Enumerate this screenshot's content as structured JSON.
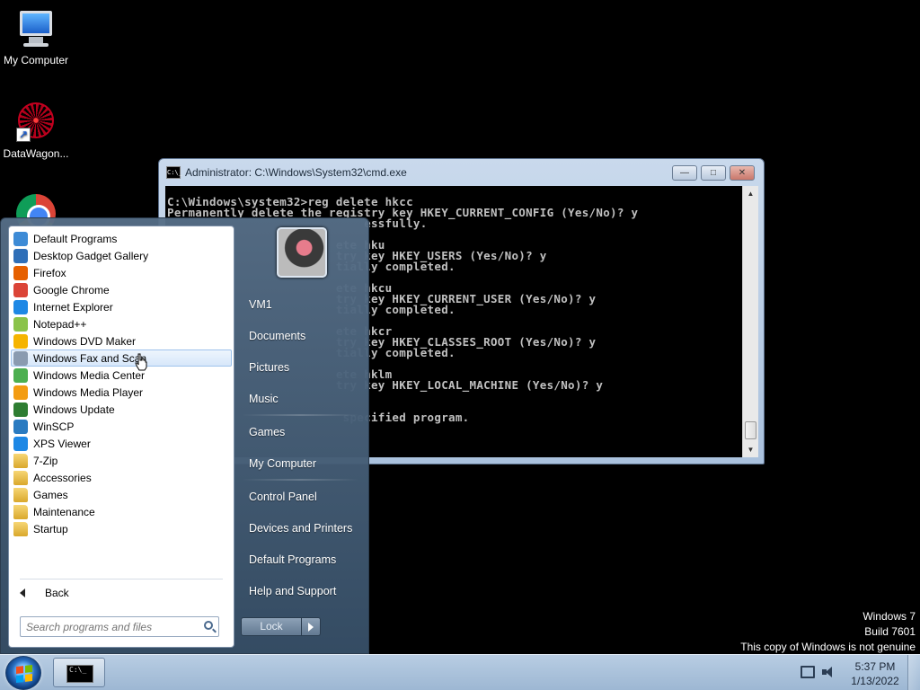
{
  "desktop": {
    "icons": [
      {
        "label": "My Computer"
      },
      {
        "label": "DataWagon..."
      },
      {
        "label": ""
      }
    ],
    "watermark": {
      "line1": "Windows 7",
      "line2": "Build 7601",
      "line3": "This copy of Windows is not genuine"
    }
  },
  "cmd_window": {
    "title": "Administrator: C:\\Windows\\System32\\cmd.exe",
    "icon_text": "C:\\_",
    "controls": {
      "minimize": "—",
      "maximize": "□",
      "close": "✕"
    },
    "lines": [
      "C:\\Windows\\system32>reg delete hkcc",
      "Permanently delete the registry key HKEY_CURRENT_CONFIG (Yes/No)? y",
      "                            essfully.",
      "",
      "                        ete hku",
      "                        try key HKEY_USERS (Yes/No)? y",
      "                        tially completed.",
      "",
      "                        ete hkcu",
      "                        try key HKEY_CURRENT_USER (Yes/No)? y",
      "                        tially completed.",
      "",
      "                        ete hkcr",
      "                        try key HKEY_CLASSES_ROOT (Yes/No)? y",
      "                        tially completed.",
      "",
      "                        ete hklm",
      "                        try key HKEY_LOCAL_MACHINE (Yes/No)? y",
      "",
      "",
      "                         specified program."
    ]
  },
  "start_menu": {
    "programs": [
      {
        "label": "Default Programs",
        "color": "#3d8bd6"
      },
      {
        "label": "Desktop Gadget Gallery",
        "color": "#2f6fb8"
      },
      {
        "label": "Firefox",
        "color": "#e66000"
      },
      {
        "label": "Google Chrome",
        "color": "#db4437"
      },
      {
        "label": "Internet Explorer",
        "color": "#1e88e5"
      },
      {
        "label": "Notepad++",
        "color": "#8bc34a"
      },
      {
        "label": "Windows DVD Maker",
        "color": "#f5b400"
      },
      {
        "label": "Windows Fax and Scan",
        "color": "#8a9bb0"
      },
      {
        "label": "Windows Media Center",
        "color": "#4caf50"
      },
      {
        "label": "Windows Media Player",
        "color": "#f39c12"
      },
      {
        "label": "Windows Update",
        "color": "#2e7d32"
      },
      {
        "label": "WinSCP",
        "color": "#2a7bc1"
      },
      {
        "label": "XPS Viewer",
        "color": "#1e88e5"
      },
      {
        "label": "7-Zip",
        "color": "folder"
      },
      {
        "label": "Accessories",
        "color": "folder"
      },
      {
        "label": "Games",
        "color": "folder"
      },
      {
        "label": "Maintenance",
        "color": "folder"
      },
      {
        "label": "Startup",
        "color": "folder"
      }
    ],
    "hovered_index": 7,
    "back_label": "Back",
    "search_placeholder": "Search programs and files",
    "right_links": [
      {
        "label": "VM1",
        "sep_after": false
      },
      {
        "label": "Documents",
        "sep_after": false
      },
      {
        "label": "Pictures",
        "sep_after": false
      },
      {
        "label": "Music",
        "sep_after": true
      },
      {
        "label": "Games",
        "sep_after": false
      },
      {
        "label": "My Computer",
        "sep_after": true
      },
      {
        "label": "Control Panel",
        "sep_after": false
      },
      {
        "label": "Devices and Printers",
        "sep_after": false
      },
      {
        "label": "Default Programs",
        "sep_after": false
      },
      {
        "label": "Help and Support",
        "sep_after": false
      }
    ],
    "lock_label": "Lock"
  },
  "taskbar": {
    "cmd_icon_text": "C:\\_",
    "clock_time": "5:37 PM",
    "clock_date": "1/13/2022"
  }
}
